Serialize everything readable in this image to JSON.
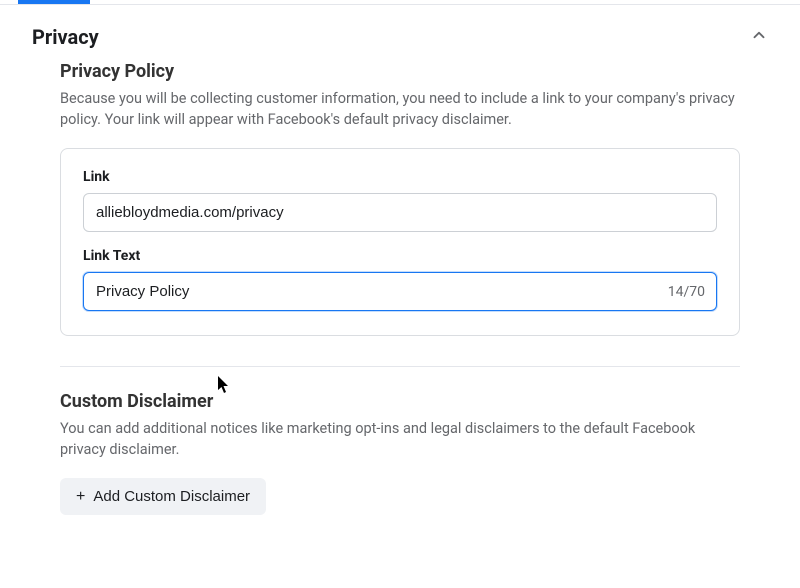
{
  "section": {
    "title": "Privacy"
  },
  "privacyPolicy": {
    "title": "Privacy Policy",
    "description": "Because you will be collecting customer information, you need to include a link to your company's privacy policy. Your link will appear with Facebook's default privacy disclaimer.",
    "link": {
      "label": "Link",
      "value": "alliebloydmedia.com/privacy"
    },
    "linkText": {
      "label": "Link Text",
      "value": "Privacy Policy",
      "count": "14/70"
    }
  },
  "customDisclaimer": {
    "title": "Custom Disclaimer",
    "description": "You can add additional notices like marketing opt-ins and legal disclaimers to the default Facebook privacy disclaimer.",
    "button": "Add Custom Disclaimer"
  }
}
